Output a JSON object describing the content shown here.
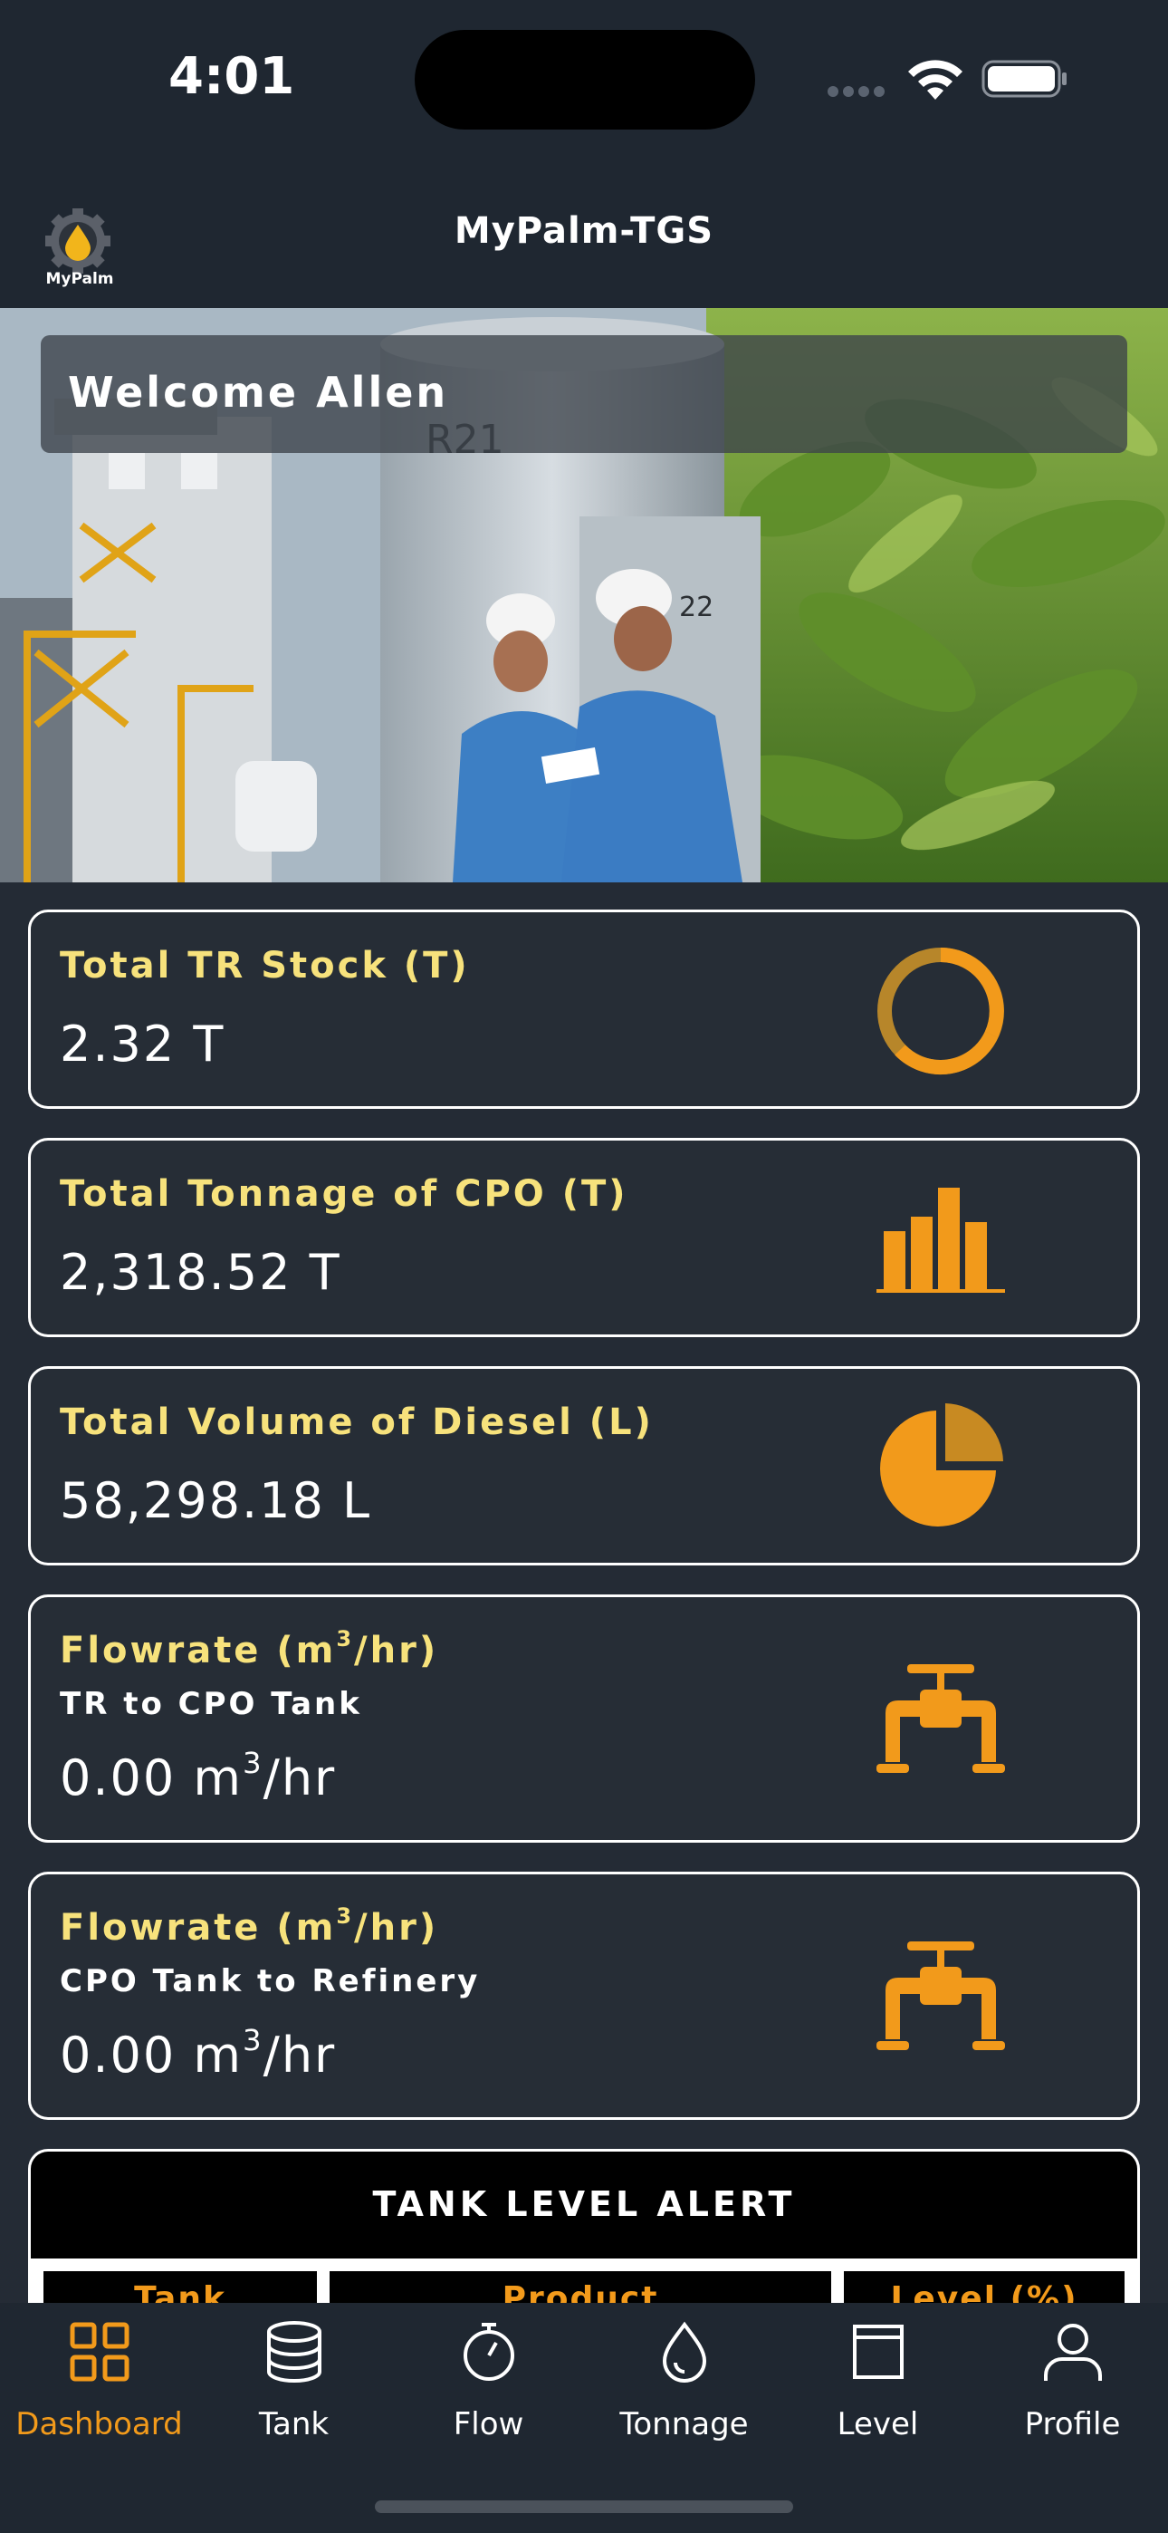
{
  "status_bar": {
    "time": "4:01"
  },
  "header": {
    "logo_text": "MyPalm",
    "title": "MyPalm-TGS"
  },
  "hero": {
    "welcome": "Welcome Allen",
    "tank_label_1": "R21",
    "tank_label_2": "22"
  },
  "cards": [
    {
      "title": "Total TR Stock (T)",
      "value": "2.32 T",
      "icon": "donut-chart-icon"
    },
    {
      "title": "Total Tonnage of CPO (T)",
      "value": "2,318.52 T",
      "icon": "bar-chart-icon"
    },
    {
      "title": "Total Volume of Diesel (L)",
      "value": "58,298.18 L",
      "icon": "pie-chart-icon"
    },
    {
      "title_prefix": "Flowrate (m",
      "title_sup": "3",
      "title_suffix": "/hr)",
      "subtitle": "TR to CPO Tank",
      "value_prefix": "0.00 m",
      "value_sup": "3",
      "value_suffix": "/hr",
      "icon": "pipe-valve-icon"
    },
    {
      "title_prefix": "Flowrate (m",
      "title_sup": "3",
      "title_suffix": "/hr)",
      "subtitle": "CPO Tank to Refinery",
      "value_prefix": "0.00 m",
      "value_sup": "3",
      "value_suffix": "/hr",
      "icon": "pipe-valve-icon"
    }
  ],
  "alert": {
    "title": "TANK LEVEL ALERT",
    "columns": [
      "Tank",
      "Product",
      "Level (%)"
    ]
  },
  "tabs": [
    {
      "label": "Dashboard",
      "icon": "grid-icon",
      "active": true
    },
    {
      "label": "Tank",
      "icon": "database-icon",
      "active": false
    },
    {
      "label": "Flow",
      "icon": "stopwatch-icon",
      "active": false
    },
    {
      "label": "Tonnage",
      "icon": "droplet-icon",
      "active": false
    },
    {
      "label": "Level",
      "icon": "bucket-icon",
      "active": false
    },
    {
      "label": "Profile",
      "icon": "user-icon",
      "active": false
    }
  ],
  "colors": {
    "accent": "#f29a1b",
    "title_yellow": "#f7e27c",
    "background": "#242b35",
    "bar": "#1f2731"
  }
}
